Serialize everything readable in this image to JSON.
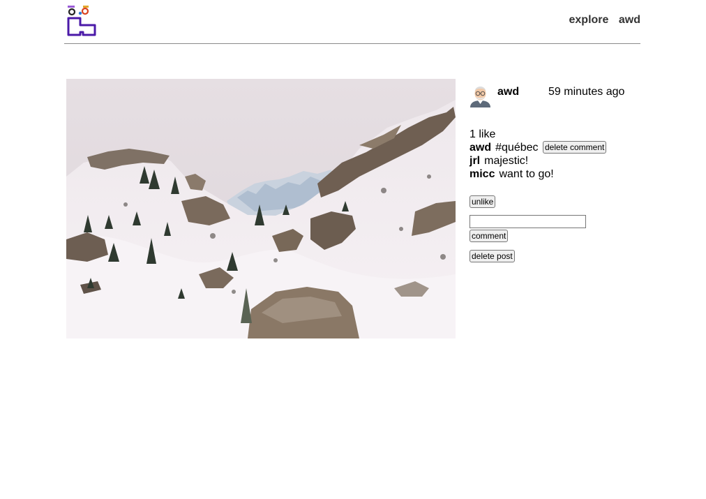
{
  "header": {
    "nav": {
      "explore_label": "explore",
      "user_label": "awd"
    }
  },
  "post": {
    "owner": "awd",
    "timestamp": "59 minutes ago",
    "likes_text": "1 like",
    "comments": [
      {
        "author": "awd",
        "text": "#québec",
        "delete_label": "delete comment"
      },
      {
        "author": "jrl",
        "text": "majestic!"
      },
      {
        "author": "micc",
        "text": "want to go!"
      }
    ],
    "unlike_label": "unlike",
    "comment_input": {
      "value": ""
    },
    "comment_button_label": "comment",
    "delete_post_label": "delete post"
  }
}
